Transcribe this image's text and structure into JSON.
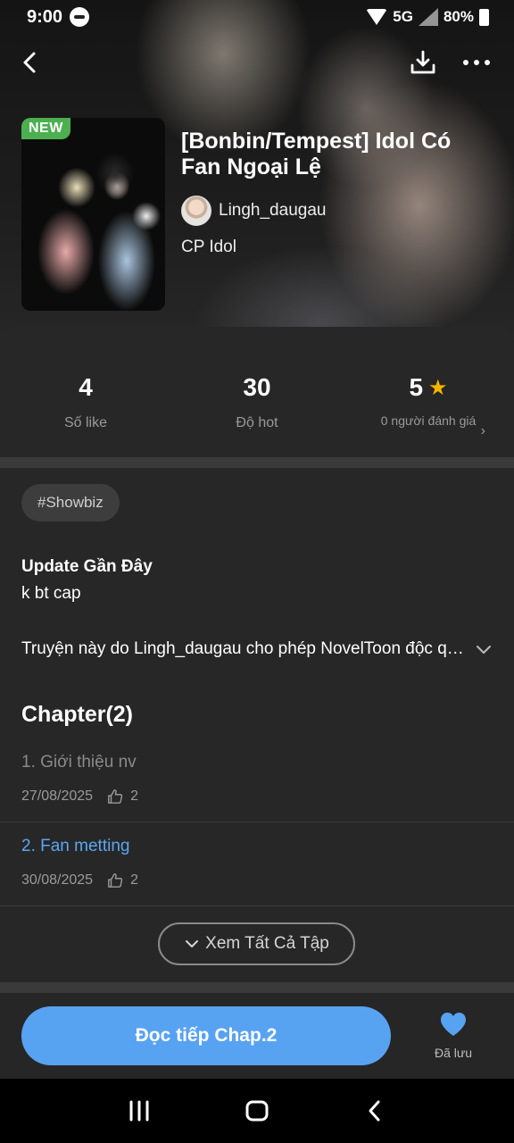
{
  "status_bar": {
    "time": "9:00",
    "network": "5G",
    "battery": "80%"
  },
  "header": {
    "badge": "NEW",
    "title": "[Bonbin/Tempest] Idol Có Fan Ngoại Lệ",
    "author": "Lingh_daugau",
    "category": "CP Idol"
  },
  "stats": {
    "likes_value": "4",
    "likes_label": "Số like",
    "hot_value": "30",
    "hot_label": "Độ hot",
    "rating_value": "5",
    "rating_label": "0 người đánh giá"
  },
  "tag": "#Showbiz",
  "update": {
    "title": "Update Gần Đây",
    "text": "k bt cap"
  },
  "permission_text": "Truyện này do Lingh_daugau cho phép NovelToon độc quyền đăng tải",
  "chapters": {
    "heading": "Chapter(2)",
    "items": [
      {
        "title": "1. Giới thiệu nv",
        "date": "27/08/2025",
        "likes": "2"
      },
      {
        "title": "2. Fan metting",
        "date": "30/08/2025",
        "likes": "2"
      }
    ],
    "see_all": "Xem Tất Cả Tập"
  },
  "bottom": {
    "read_button": "Đọc tiếp Chap.2",
    "saved_label": "Đã lưu"
  },
  "colors": {
    "accent": "#58a2f2",
    "new_badge": "#4caf50",
    "star": "#f5b400",
    "panel": "#272727"
  },
  "icons": [
    "back-icon",
    "download-icon",
    "more-icon",
    "star-icon",
    "chevron-right-icon",
    "chevron-down-icon",
    "thumb-up-icon",
    "heart-icon",
    "recents-icon",
    "home-icon",
    "nav-back-icon"
  ]
}
